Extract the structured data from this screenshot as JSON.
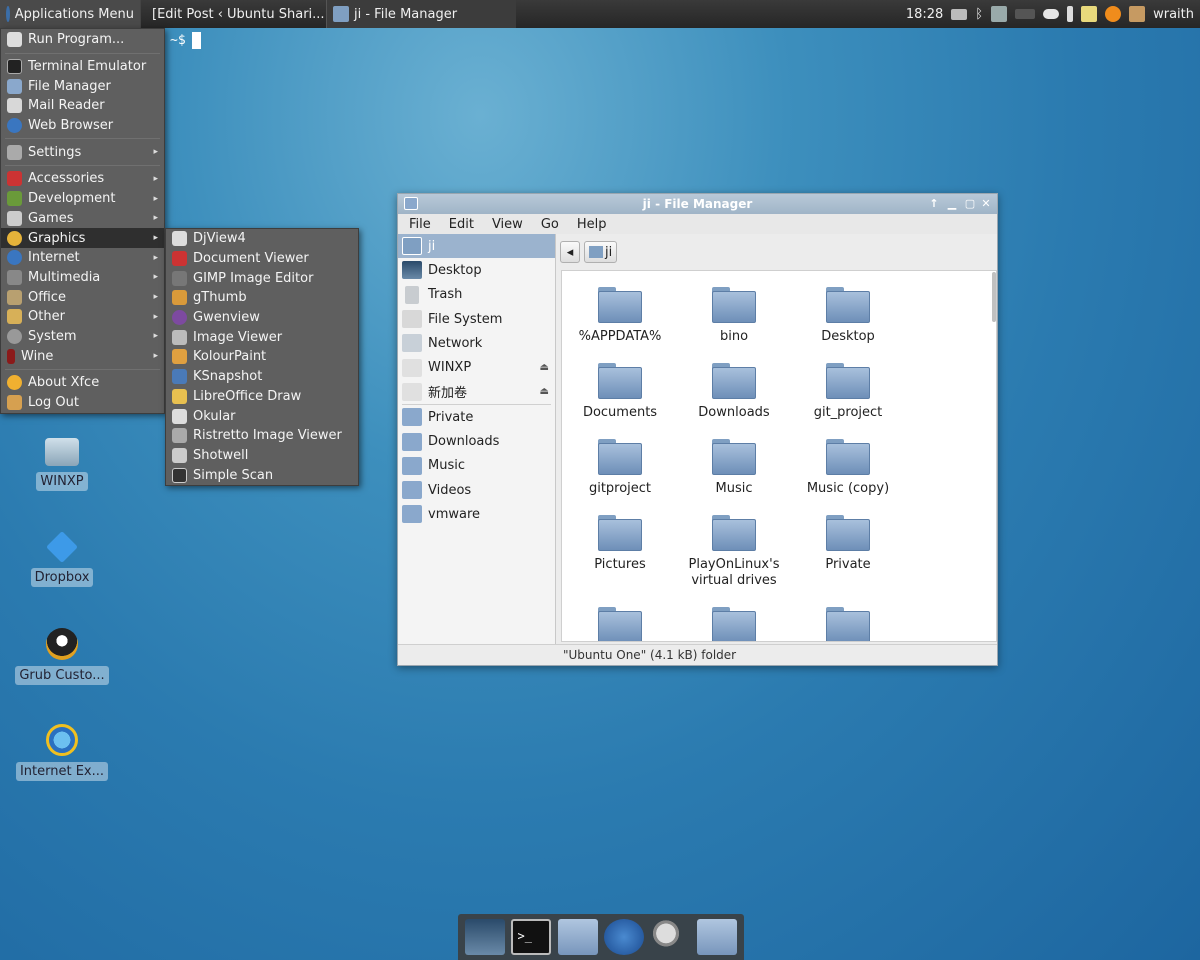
{
  "panel": {
    "app_menu_label": "Applications Menu",
    "tasks": [
      "[Edit Post ‹ Ubuntu Shari...",
      "ji - File Manager"
    ],
    "clock": "18:28",
    "user": "wraith"
  },
  "terminal": {
    "prompt": "~$"
  },
  "menu": {
    "items": [
      {
        "label": "Run Program...",
        "icon": "run-icon"
      },
      {
        "label": "Terminal Emulator",
        "icon": "terminal-icon"
      },
      {
        "label": "File Manager",
        "icon": "file-manager-icon"
      },
      {
        "label": "Mail Reader",
        "icon": "mail-icon"
      },
      {
        "label": "Web Browser",
        "icon": "globe-icon"
      },
      {
        "label": "Settings",
        "icon": "settings-icon"
      },
      {
        "label": "Accessories",
        "icon": "accessories-icon"
      },
      {
        "label": "Development",
        "icon": "development-icon"
      },
      {
        "label": "Games",
        "icon": "games-icon"
      },
      {
        "label": "Graphics",
        "icon": "graphics-icon"
      },
      {
        "label": "Internet",
        "icon": "internet-icon"
      },
      {
        "label": "Multimedia",
        "icon": "multimedia-icon"
      },
      {
        "label": "Office",
        "icon": "office-icon"
      },
      {
        "label": "Other",
        "icon": "other-icon"
      },
      {
        "label": "System",
        "icon": "system-icon"
      },
      {
        "label": "Wine",
        "icon": "wine-icon"
      },
      {
        "label": "About Xfce",
        "icon": "star-icon"
      },
      {
        "label": "Log Out",
        "icon": "logout-icon"
      }
    ]
  },
  "submenu": {
    "items": [
      "DjView4",
      "Document Viewer",
      "GIMP Image Editor",
      "gThumb",
      "Gwenview",
      "Image Viewer",
      "KolourPaint",
      "KSnapshot",
      "LibreOffice Draw",
      "Okular",
      "Ristretto Image Viewer",
      "Shotwell",
      "Simple Scan"
    ]
  },
  "desktop": {
    "icons": [
      "WINXP",
      "Dropbox",
      "Grub Custo...",
      "Internet Ex..."
    ]
  },
  "fm": {
    "title": "ji - File Manager",
    "menus": [
      "File",
      "Edit",
      "View",
      "Go",
      "Help"
    ],
    "sidebar": [
      "ji",
      "Desktop",
      "Trash",
      "File System",
      "Network",
      "WINXP",
      "新加卷",
      "Private",
      "Downloads",
      "Music",
      "Videos",
      "vmware"
    ],
    "path_current": "ji",
    "files": [
      "%APPDATA%",
      "bino",
      "Desktop",
      "Documents",
      "Downloads",
      "git_project",
      "gitproject",
      "Music",
      "Music (copy)",
      "Pictures",
      "PlayOnLinux's virtual drives",
      "Private"
    ],
    "status": "\"Ubuntu One\" (4.1 kB) folder"
  },
  "colors": {
    "menu_bg": "#5f5f5f",
    "selection": "#9bb3ce",
    "folder": "#8aa8cc"
  }
}
